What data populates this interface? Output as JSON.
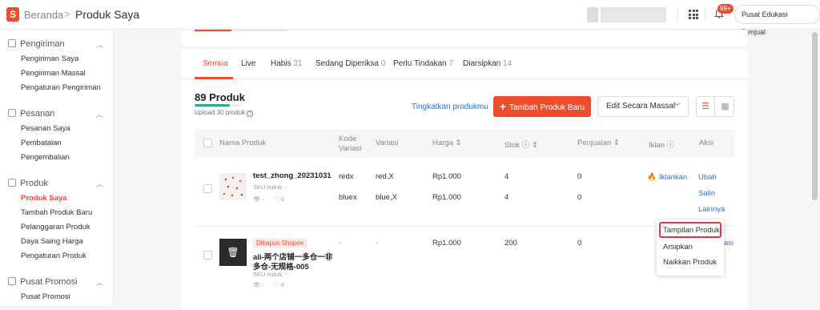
{
  "header": {
    "logo_letter": "S",
    "home": "Beranda",
    "separator": ">",
    "page_title": "Produk Saya",
    "notif_badge": "99+",
    "edu_button": "Pusat Edukasi Penjual"
  },
  "sidebar": {
    "sections": [
      {
        "title": "Pengiriman",
        "items": [
          "Pengiriman Saya",
          "Pengiriman Massal",
          "Pengaturan Pengiriman"
        ]
      },
      {
        "title": "Pesanan",
        "items": [
          "Pesanan Saya",
          "Pembatalan",
          "Pengembalian"
        ]
      },
      {
        "title": "Produk",
        "items": [
          "Produk Saya",
          "Tambah Produk Baru",
          "Pelanggaran Produk",
          "Daya Saing Harga",
          "Pengaturan Produk"
        ]
      },
      {
        "title": "Pusat Promosi",
        "items": [
          "Pusat Promosi"
        ]
      }
    ]
  },
  "tabs": [
    {
      "label": "Semua",
      "count": ""
    },
    {
      "label": "Live",
      "count": ""
    },
    {
      "label": "Habis",
      "count": "31"
    },
    {
      "label": "Sedang Diperiksa",
      "count": "0"
    },
    {
      "label": "Perlu Tindakan",
      "count": "7"
    },
    {
      "label": "Diarsipkan",
      "count": "14"
    }
  ],
  "summary": {
    "product_count": "89 Produk",
    "upload_progress": 0.75,
    "upload_text": "Upload 30 produk",
    "upgrade_link": "Tingkatkan produkmu",
    "add_button": "Tambah Produk Baru",
    "bulk_edit": "Edit Secara Massal"
  },
  "table": {
    "headers": [
      "Nama Produk",
      "Kode Variasi",
      "Variasi",
      "Harga",
      "Stok",
      "Penjualan",
      "Iklan",
      "Aksi"
    ],
    "rows": [
      {
        "name": "test_zhong_20231031",
        "sku": "SKU Induk: -",
        "views": "-",
        "likes": "0",
        "variants": [
          {
            "code": "redx",
            "variation": "red,X",
            "price": "Rp1.000",
            "stock": "4",
            "sales": "0"
          },
          {
            "code": "bluex",
            "variation": "blue,X",
            "price": "Rp1.000",
            "stock": "4",
            "sales": "0"
          }
        ],
        "ad": "Iklankan",
        "actions": [
          "Ubah",
          "Salin",
          "Lainnya"
        ]
      },
      {
        "tag": "Dihapus Shopee",
        "name_line1": "ali-两个店铺一多仓一非",
        "name_line2": "多仓-无规格-005",
        "sku": "SKU Induk: -",
        "views": "-",
        "likes": "0",
        "code": "-",
        "variation": "-",
        "price": "Rp1.000",
        "stock": "200",
        "sales": "0",
        "ad_partial": "asi"
      }
    ]
  },
  "dropdown": {
    "items": [
      "Tampilan Produk",
      "Arsipkan",
      "Naikkan Produk"
    ]
  }
}
